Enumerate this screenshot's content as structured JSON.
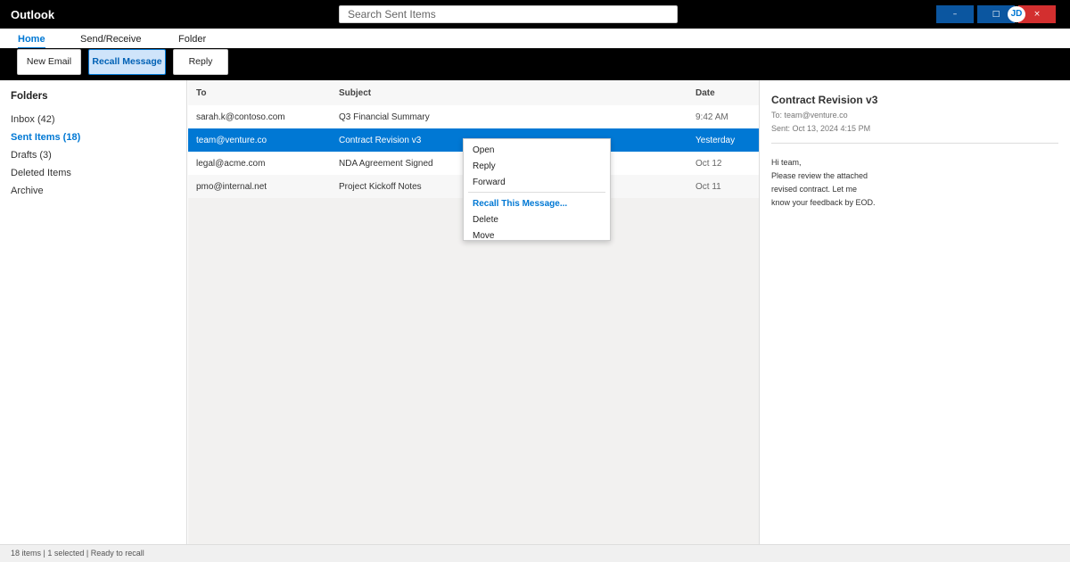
{
  "app": {
    "title": "Outlook"
  },
  "search": {
    "placeholder": "Search Sent Items"
  },
  "window": {
    "minimize": "–",
    "maximize": "□",
    "close": "×",
    "avatar_initials": "JD"
  },
  "tabs": [
    "Home",
    "Send/Receive",
    "Folder"
  ],
  "ribbon": {
    "new_email": "New Email",
    "recall_message": "Recall Message",
    "reply": "Reply"
  },
  "folders": {
    "heading": "Folders",
    "items": [
      "Inbox (42)",
      "Sent Items (18)",
      "Drafts (3)",
      "Deleted Items",
      "Archive"
    ]
  },
  "list": {
    "columns": {
      "to": "To",
      "subject": "Subject",
      "date": "Date"
    },
    "rows": [
      {
        "to": "sarah.k@contoso.com",
        "subject": "Q3 Financial Summary",
        "date": "9:42 AM"
      },
      {
        "to": "team@venture.co",
        "subject": "Contract Revision v3",
        "date": "Yesterday"
      },
      {
        "to": "legal@acme.com",
        "subject": "NDA Agreement Signed",
        "date": "Oct 12"
      },
      {
        "to": "pmo@internal.net",
        "subject": "Project Kickoff Notes",
        "date": "Oct 11"
      }
    ]
  },
  "context_menu": [
    "Open",
    "Reply",
    "Forward",
    "Recall This Message...",
    "Delete",
    "Move"
  ],
  "reading": {
    "title": "Contract Revision v3",
    "to": "To: team@venture.co",
    "sent": "Sent: Oct 13, 2024 4:15 PM",
    "body": [
      "Hi team,",
      "Please review the attached",
      "revised contract. Let me",
      "know your feedback by EOD."
    ]
  },
  "status": {
    "text": "18 items | 1 selected | Ready to recall"
  },
  "colors": {
    "accent": "#0078d4",
    "titlebar": "#000000",
    "close": "#d32f2f",
    "window_button": "#0b56a0"
  }
}
